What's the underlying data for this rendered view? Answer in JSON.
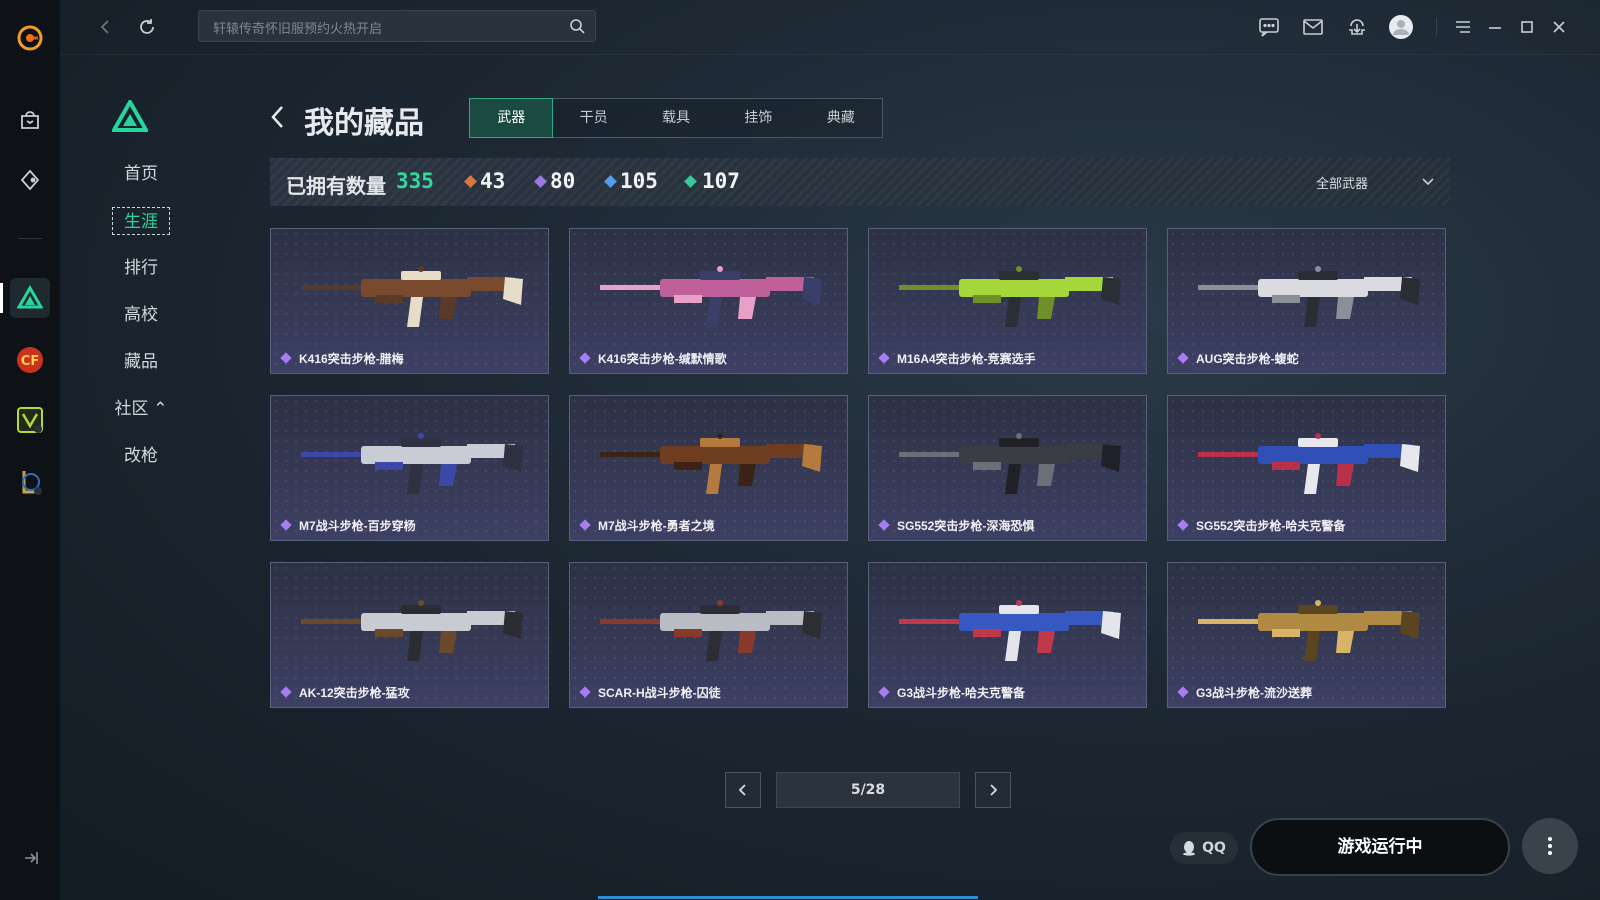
{
  "topbar": {
    "search_placeholder": "轩辕传奇怀旧服预约火热开启"
  },
  "nav": {
    "items": [
      {
        "label": "首页"
      },
      {
        "label": "生涯"
      },
      {
        "label": "排行"
      },
      {
        "label": "高校"
      },
      {
        "label": "藏品"
      },
      {
        "label": "社区 ⌃"
      },
      {
        "label": "改枪"
      }
    ],
    "active": "生涯"
  },
  "page": {
    "title": "我的藏品",
    "tabs": [
      {
        "label": "武器"
      },
      {
        "label": "干员"
      },
      {
        "label": "载具"
      },
      {
        "label": "挂饰"
      },
      {
        "label": "典藏"
      }
    ],
    "active_tab": "武器"
  },
  "stats": {
    "owned_label": "已拥有数量",
    "owned_total": "335",
    "tiers": [
      {
        "value": "43",
        "color": "#e0753a"
      },
      {
        "value": "80",
        "color": "#9b78e8"
      },
      {
        "value": "105",
        "color": "#4f9ef0"
      },
      {
        "value": "107",
        "color": "#36c99a"
      }
    ],
    "filter_label": "全部武器"
  },
  "weapons": [
    {
      "name": "K416突击步枪-腊梅",
      "palette": [
        "#7a4a2e",
        "#e6dcc8",
        "#5a3a28"
      ]
    },
    {
      "name": "K416突击步枪-缄默情歌",
      "palette": [
        "#c0609a",
        "#3a3f6a",
        "#e8a0c8"
      ]
    },
    {
      "name": "M16A4突击步枪-竞赛选手",
      "palette": [
        "#a5d63a",
        "#2a2f35",
        "#6f8f2a"
      ]
    },
    {
      "name": "AUG突击步枪-蝮蛇",
      "palette": [
        "#d9dbe0",
        "#2a2d33",
        "#8a8f98"
      ]
    },
    {
      "name": "M7战斗步枪-百步穿杨",
      "palette": [
        "#c9ccd4",
        "#2f3140",
        "#3c48a8"
      ]
    },
    {
      "name": "M7战斗步枪-勇者之境",
      "palette": [
        "#6e3d22",
        "#b57a3e",
        "#3b2416"
      ]
    },
    {
      "name": "SG552突击步枪-深海恐惧",
      "palette": [
        "#3a3d44",
        "#1f2126",
        "#6a6f78"
      ]
    },
    {
      "name": "SG552突击步枪-哈夫克警备",
      "palette": [
        "#3050b8",
        "#e6e8ee",
        "#b8304a"
      ]
    },
    {
      "name": "AK-12突击步枪-猛攻",
      "palette": [
        "#c8ccd2",
        "#2b2d32",
        "#6a4a2a"
      ]
    },
    {
      "name": "SCAR-H战斗步枪-囚徒",
      "palette": [
        "#b9bcc2",
        "#2c2e33",
        "#8a3a2a"
      ]
    },
    {
      "name": "G3战斗步枪-哈夫克警备",
      "palette": [
        "#3658c0",
        "#e3e5ea",
        "#c0384a"
      ]
    },
    {
      "name": "G3战斗步枪-流沙送葬",
      "palette": [
        "#b08a42",
        "#5a4422",
        "#d8b468"
      ]
    }
  ],
  "pager": {
    "page_text": "5/28"
  },
  "footer": {
    "qq_label": "QQ",
    "run_label": "游戏运行中"
  },
  "colors": {
    "accent": "#27d69d",
    "card_border": "#59607a",
    "rarity_diamond": "#a77ef0"
  }
}
